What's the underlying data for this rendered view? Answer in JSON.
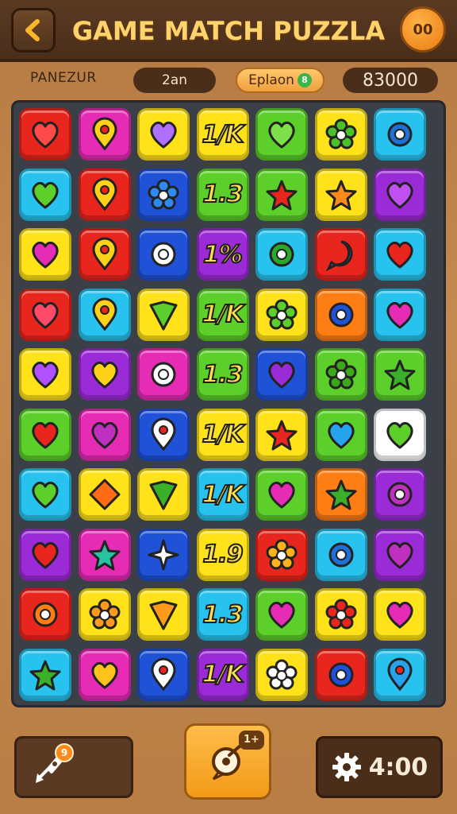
{
  "header": {
    "title": "GAME MATCH PUZZLA",
    "pause_label": "00"
  },
  "stats": {
    "label": "PANEZUR",
    "moves": "2an",
    "option": "Eplaon",
    "option_badge": "8",
    "score": "83000"
  },
  "bottom": {
    "booster_badge": "9",
    "hint_badge": "1+",
    "timer": "4:00"
  },
  "colors": {
    "red": "#e8261e",
    "magenta": "#e62bb5",
    "yellow": "#ffe21a",
    "green": "#5ccf2a",
    "cyan": "#27c3ee",
    "blue": "#1f52d6",
    "purple": "#9b2bd6",
    "orange": "#ff7e14",
    "white": "#ffffff"
  },
  "board": {
    "rows": [
      [
        {
          "c": "red",
          "i": "heart",
          "f": "#ff4a4a"
        },
        {
          "c": "magenta",
          "i": "pin",
          "f": "#ffd21a"
        },
        {
          "c": "yellow",
          "i": "heart",
          "f": "#b070ff"
        },
        {
          "c": "yellow",
          "t": "1/K"
        },
        {
          "c": "green",
          "i": "heart",
          "f": "#7de04a"
        },
        {
          "c": "yellow",
          "i": "flower",
          "f": "#4ac02a"
        },
        {
          "c": "cyan",
          "i": "ring",
          "f": "#1f70d6"
        }
      ],
      [
        {
          "c": "cyan",
          "i": "heart",
          "f": "#5ccf2a"
        },
        {
          "c": "red",
          "i": "pin",
          "f": "#ffd21a"
        },
        {
          "c": "blue",
          "i": "flower",
          "f": "#2e8af0"
        },
        {
          "c": "green",
          "t": "1.3"
        },
        {
          "c": "green",
          "i": "star",
          "f": "#e8261e"
        },
        {
          "c": "yellow",
          "i": "star",
          "f": "#ff8a1c"
        },
        {
          "c": "purple",
          "i": "heart",
          "f": "#c050f0"
        }
      ],
      [
        {
          "c": "yellow",
          "i": "heart",
          "f": "#e62bb5"
        },
        {
          "c": "red",
          "i": "pin",
          "f": "#ffd21a"
        },
        {
          "c": "blue",
          "i": "ring",
          "f": "#ffffff"
        },
        {
          "c": "purple",
          "t": "1%"
        },
        {
          "c": "cyan",
          "i": "ring",
          "f": "#2aa82a"
        },
        {
          "c": "red",
          "i": "bubble",
          "f": "#2e6ae0"
        },
        {
          "c": "cyan",
          "i": "heart",
          "f": "#e8261e"
        }
      ],
      [
        {
          "c": "red",
          "i": "heart",
          "f": "#ff4a6a"
        },
        {
          "c": "cyan",
          "i": "pin",
          "f": "#ffd21a"
        },
        {
          "c": "yellow",
          "i": "shield",
          "f": "#5ccf2a"
        },
        {
          "c": "green",
          "t": "1/K"
        },
        {
          "c": "yellow",
          "i": "flower",
          "f": "#5ccf2a"
        },
        {
          "c": "orange",
          "i": "ring",
          "f": "#1f52d6"
        },
        {
          "c": "cyan",
          "i": "heart",
          "f": "#e62bb5"
        }
      ],
      [
        {
          "c": "yellow",
          "i": "heart",
          "f": "#b050ff"
        },
        {
          "c": "purple",
          "i": "heart",
          "f": "#ffd21a"
        },
        {
          "c": "magenta",
          "i": "ring",
          "f": "#ffffff"
        },
        {
          "c": "green",
          "t": "1.3"
        },
        {
          "c": "blue",
          "i": "heart",
          "f": "#9b2bd6"
        },
        {
          "c": "green",
          "i": "flower",
          "f": "#3aa81a"
        },
        {
          "c": "green",
          "i": "star",
          "f": "#3ab02a"
        }
      ],
      [
        {
          "c": "green",
          "i": "heart",
          "f": "#e8261e"
        },
        {
          "c": "magenta",
          "i": "heart",
          "f": "#c030c0"
        },
        {
          "c": "blue",
          "i": "pin",
          "f": "#ffffff"
        },
        {
          "c": "yellow",
          "t": "1/K"
        },
        {
          "c": "yellow",
          "i": "star",
          "f": "#e8261e"
        },
        {
          "c": "green",
          "i": "heart",
          "f": "#27a3ee"
        },
        {
          "c": "white",
          "i": "heart",
          "f": "#5ccf2a"
        }
      ],
      [
        {
          "c": "cyan",
          "i": "heart",
          "f": "#5ccf2a"
        },
        {
          "c": "yellow",
          "i": "diamond",
          "f": "#ff6a14"
        },
        {
          "c": "yellow",
          "i": "shield",
          "f": "#3ab02a"
        },
        {
          "c": "cyan",
          "t": "1/K"
        },
        {
          "c": "green",
          "i": "heart",
          "f": "#e62bb5"
        },
        {
          "c": "orange",
          "i": "star",
          "f": "#3ab02a"
        },
        {
          "c": "purple",
          "i": "ring",
          "f": "#c030c0"
        }
      ],
      [
        {
          "c": "purple",
          "i": "heart",
          "f": "#e8261e"
        },
        {
          "c": "magenta",
          "i": "star",
          "f": "#27c3a0"
        },
        {
          "c": "blue",
          "i": "sparkle",
          "f": "#ffffff"
        },
        {
          "c": "yellow",
          "t": "1.9"
        },
        {
          "c": "red",
          "i": "flower",
          "f": "#ffb21a"
        },
        {
          "c": "cyan",
          "i": "ring",
          "f": "#1f70d6"
        },
        {
          "c": "purple",
          "i": "heart",
          "f": "#c030c0"
        }
      ],
      [
        {
          "c": "red",
          "i": "ring",
          "f": "#ff7e14"
        },
        {
          "c": "yellow",
          "i": "flower",
          "f": "#ff9a1c"
        },
        {
          "c": "yellow",
          "i": "shield",
          "f": "#ff9a1c"
        },
        {
          "c": "cyan",
          "t": "1.3"
        },
        {
          "c": "green",
          "i": "heart",
          "f": "#e62bb5"
        },
        {
          "c": "yellow",
          "i": "flower",
          "f": "#e8261e"
        },
        {
          "c": "yellow",
          "i": "heart",
          "f": "#e62bb5"
        }
      ],
      [
        {
          "c": "cyan",
          "i": "star",
          "f": "#3ab02a"
        },
        {
          "c": "magenta",
          "i": "heart",
          "f": "#ffc21a"
        },
        {
          "c": "blue",
          "i": "pin",
          "f": "#ffffff"
        },
        {
          "c": "purple",
          "t": "1/K"
        },
        {
          "c": "yellow",
          "i": "flower",
          "f": "#ffffff"
        },
        {
          "c": "red",
          "i": "ring",
          "f": "#1f52d6"
        },
        {
          "c": "cyan",
          "i": "pin",
          "f": "#27a3ee"
        }
      ]
    ]
  }
}
